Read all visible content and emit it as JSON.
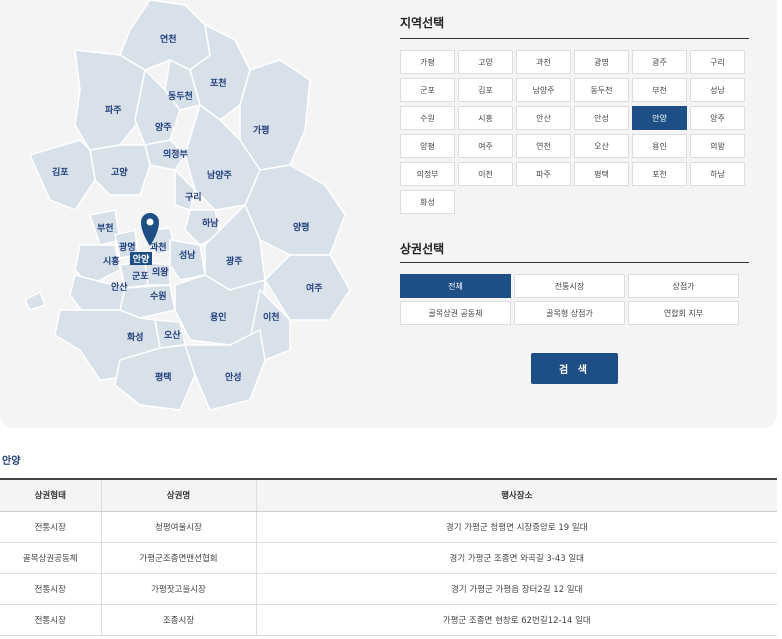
{
  "map": {
    "labels": {
      "yeoncheon": "연천",
      "pocheon": "포천",
      "dongducheon": "동두천",
      "paju": "파주",
      "yangju": "양주",
      "gapyeong": "가평",
      "uijeongbu": "의정부",
      "gimpo": "김포",
      "goyang": "고양",
      "namyangju": "남양주",
      "guri": "구리",
      "hanam": "하남",
      "bucheon": "부천",
      "gwangmyeong": "광명",
      "gwacheon": "과천",
      "siheung": "시흥",
      "anyang": "안양",
      "gunpo": "군포",
      "seongnam": "성남",
      "uiwang": "의왕",
      "gwangju": "광주",
      "yangpyeong": "양평",
      "ansan": "안산",
      "suwon": "수원",
      "yeoju": "여주",
      "yongin": "용인",
      "icheon": "이천",
      "hwaseong": "화성",
      "osan": "오산",
      "pyeongtaek": "평택",
      "anseong": "안성"
    },
    "selected": "안양",
    "pin_color": "#1d4f86"
  },
  "region": {
    "title": "지역선택",
    "options": [
      "가평",
      "고양",
      "과천",
      "광명",
      "광주",
      "구리",
      "군포",
      "김포",
      "남양주",
      "동두천",
      "부천",
      "성남",
      "수원",
      "시흥",
      "안산",
      "안성",
      "안양",
      "양주",
      "양평",
      "여주",
      "연천",
      "오산",
      "용인",
      "의왕",
      "의정부",
      "이천",
      "파주",
      "평택",
      "포천",
      "하남",
      "화성"
    ],
    "selected": "안양"
  },
  "market": {
    "title": "상권선택",
    "options": [
      "전체",
      "전통시장",
      "상점가",
      "골목상권 공동체",
      "골목형 상점가",
      "연합회 지부"
    ],
    "selected": "전체"
  },
  "search_label": "검 색",
  "result": {
    "title": "안양",
    "headers": [
      "상권형태",
      "상권명",
      "행사장소"
    ],
    "rows": [
      [
        "전통시장",
        "청평여울시장",
        "경기 가평군 청평면 시장중앙로 19 일대"
      ],
      [
        "골목상권공동체",
        "가평군조종면맨션협회",
        "경기 가평군 조종면 와곡길 3-43 일대"
      ],
      [
        "전통시장",
        "가평잣고을시장",
        "경기 가평군 가평읍 장터2길 12 일대"
      ],
      [
        "전통시장",
        "조종시장",
        "가평군 조종면 현창로 62번길12-14 일대"
      ]
    ]
  },
  "colors": {
    "accent": "#1d4f86",
    "map_fill": "#d8e0ea",
    "map_stroke": "#ffffff"
  }
}
